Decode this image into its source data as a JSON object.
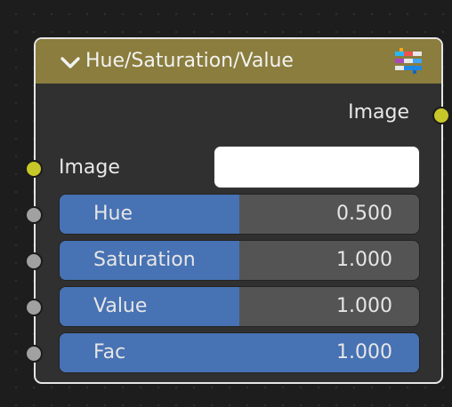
{
  "node": {
    "title": "Hue/Saturation/Value",
    "header_color": "#8a7d3d",
    "output_label": "Image",
    "input_image_label": "Image",
    "input_color": "#ffffff",
    "sliders": [
      {
        "label": "Hue",
        "value": "0.500",
        "fill_fraction": 0.5
      },
      {
        "label": "Saturation",
        "value": "1.000",
        "fill_fraction": 0.5
      },
      {
        "label": "Value",
        "value": "1.000",
        "fill_fraction": 0.5
      },
      {
        "label": "Fac",
        "value": "1.000",
        "fill_fraction": 1.0
      }
    ]
  },
  "colors": {
    "slider_fill": "#4772b3",
    "color_socket": "#c7c729",
    "float_socket": "#a1a1a1"
  },
  "icons": {
    "collapse": "chevron-down-icon",
    "node_type": "color-node-icon"
  }
}
